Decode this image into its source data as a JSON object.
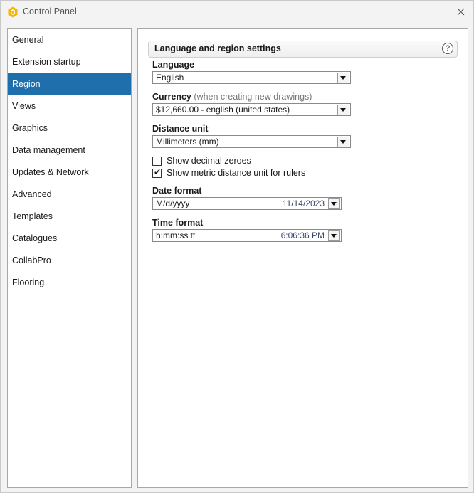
{
  "window": {
    "title": "Control Panel"
  },
  "sidebar": {
    "items": [
      {
        "label": "General"
      },
      {
        "label": "Extension startup"
      },
      {
        "label": "Region",
        "active": true
      },
      {
        "label": "Views"
      },
      {
        "label": "Graphics"
      },
      {
        "label": "Data management"
      },
      {
        "label": "Updates & Network"
      },
      {
        "label": "Advanced"
      },
      {
        "label": "Templates"
      },
      {
        "label": "Catalogues"
      },
      {
        "label": "CollabPro"
      },
      {
        "label": "Flooring"
      }
    ]
  },
  "section": {
    "title": "Language and region settings",
    "help": "?"
  },
  "language": {
    "label": "Language",
    "value": "English"
  },
  "currency": {
    "label": "Currency",
    "hint": "(when creating new drawings)",
    "value": "$12,660.00 - english (united states)"
  },
  "distance_unit": {
    "label": "Distance unit",
    "value": "Millimeters (mm)"
  },
  "options": {
    "show_decimal_zeroes": {
      "label": "Show decimal zeroes",
      "checked": false
    },
    "show_metric_rulers": {
      "label": "Show metric distance unit for rulers",
      "checked": true
    }
  },
  "date_format": {
    "label": "Date format",
    "value": "M/d/yyyy",
    "preview": "11/14/2023"
  },
  "time_format": {
    "label": "Time format",
    "value": "h:mm:ss tt",
    "preview": "6:06:36 PM"
  },
  "colors": {
    "accent": "#1f6fad",
    "app_icon": "#f2b705"
  }
}
